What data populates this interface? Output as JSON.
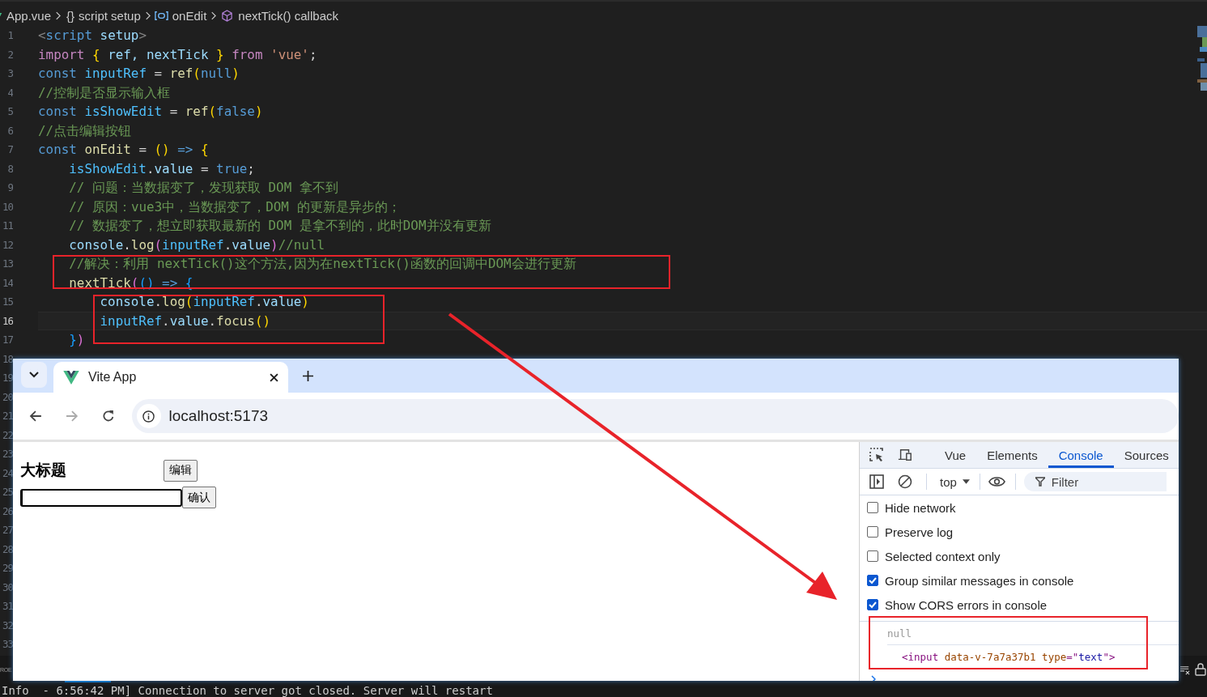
{
  "breadcrumbs": [
    {
      "kind": "file",
      "label": "App.vue"
    },
    {
      "kind": "block",
      "symbol": "{}",
      "label": "script setup"
    },
    {
      "kind": "variable",
      "label": "onEdit"
    },
    {
      "kind": "method",
      "label": "nextTick() callback"
    }
  ],
  "code": {
    "lines": [
      {
        "number": "1",
        "current": false,
        "tokens": [
          {
            "text": "<",
            "kind": "tagp"
          },
          {
            "text": "script ",
            "kind": "tag"
          },
          {
            "text": "setup",
            "kind": "var"
          },
          {
            "text": ">",
            "kind": "tagp"
          }
        ]
      },
      {
        "number": "2",
        "current": false,
        "tokens": [
          {
            "text": "import ",
            "kind": "keyword"
          },
          {
            "text": "{",
            "kind": "b1"
          },
          {
            "text": " ref, nextTick ",
            "kind": "var"
          },
          {
            "text": "}",
            "kind": "b1"
          },
          {
            "text": " from ",
            "kind": "keyword"
          },
          {
            "text": "'vue'",
            "kind": "string"
          },
          {
            "text": ";",
            "kind": "punct"
          }
        ]
      },
      {
        "number": "3",
        "current": false,
        "tokens": [
          {
            "text": "const ",
            "kind": "storage"
          },
          {
            "text": "inputRef",
            "kind": "const"
          },
          {
            "text": " = ",
            "kind": "punct"
          },
          {
            "text": "ref",
            "kind": "func"
          },
          {
            "text": "(",
            "kind": "b1"
          },
          {
            "text": "null",
            "kind": "storage"
          },
          {
            "text": ")",
            "kind": "b1"
          }
        ]
      },
      {
        "number": "4",
        "current": false,
        "tokens": [
          {
            "text": "//控制是否显示输入框",
            "kind": "comment"
          }
        ]
      },
      {
        "number": "5",
        "current": false,
        "tokens": [
          {
            "text": "const ",
            "kind": "storage"
          },
          {
            "text": "isShowEdit",
            "kind": "const"
          },
          {
            "text": " = ",
            "kind": "punct"
          },
          {
            "text": "ref",
            "kind": "func"
          },
          {
            "text": "(",
            "kind": "b1"
          },
          {
            "text": "false",
            "kind": "storage"
          },
          {
            "text": ")",
            "kind": "b1"
          }
        ]
      },
      {
        "number": "6",
        "current": false,
        "tokens": [
          {
            "text": "//点击编辑按钮",
            "kind": "comment"
          }
        ]
      },
      {
        "number": "7",
        "current": false,
        "tokens": [
          {
            "text": "const ",
            "kind": "storage"
          },
          {
            "text": "onEdit",
            "kind": "func"
          },
          {
            "text": " = ",
            "kind": "punct"
          },
          {
            "text": "()",
            "kind": "b1"
          },
          {
            "text": " => ",
            "kind": "storage"
          },
          {
            "text": "{",
            "kind": "b1"
          }
        ]
      },
      {
        "number": "8",
        "current": false,
        "tokens": [
          {
            "text": "    isShowEdit",
            "kind": "const"
          },
          {
            "text": ".",
            "kind": "punct"
          },
          {
            "text": "value",
            "kind": "var"
          },
          {
            "text": " = ",
            "kind": "punct"
          },
          {
            "text": "true",
            "kind": "storage"
          },
          {
            "text": ";",
            "kind": "punct"
          }
        ]
      },
      {
        "number": "9",
        "current": false,
        "tokens": [
          {
            "text": "    // 问题：当数据变了，发现获取 DOM 拿不到",
            "kind": "comment"
          }
        ]
      },
      {
        "number": "10",
        "current": false,
        "tokens": [
          {
            "text": "    // 原因：vue3中，当数据变了，DOM 的更新是异步的；",
            "kind": "comment"
          }
        ]
      },
      {
        "number": "11",
        "current": false,
        "tokens": [
          {
            "text": "    // 数据变了，想立即获取最新的 DOM 是拿不到的，此时DOM并没有更新",
            "kind": "comment"
          }
        ]
      },
      {
        "number": "12",
        "current": false,
        "tokens": [
          {
            "text": "    console",
            "kind": "var"
          },
          {
            "text": ".",
            "kind": "punct"
          },
          {
            "text": "log",
            "kind": "func"
          },
          {
            "text": "(",
            "kind": "b2"
          },
          {
            "text": "inputRef",
            "kind": "const"
          },
          {
            "text": ".",
            "kind": "punct"
          },
          {
            "text": "value",
            "kind": "var"
          },
          {
            "text": ")",
            "kind": "b2"
          },
          {
            "text": "//null",
            "kind": "comment"
          }
        ]
      },
      {
        "number": "13",
        "current": false,
        "tokens": [
          {
            "text": "    //解决：利用 nextTick()这个方法,因为在nextTick()函数的回调中DOM会进行更新",
            "kind": "comment"
          }
        ]
      },
      {
        "number": "14",
        "current": false,
        "tokens": [
          {
            "text": "    nextTick",
            "kind": "func"
          },
          {
            "text": "(",
            "kind": "b2"
          },
          {
            "text": "()",
            "kind": "b3"
          },
          {
            "text": " => ",
            "kind": "storage"
          },
          {
            "text": "{",
            "kind": "b3"
          }
        ]
      },
      {
        "number": "15",
        "current": false,
        "tokens": [
          {
            "text": "        console",
            "kind": "var"
          },
          {
            "text": ".",
            "kind": "punct"
          },
          {
            "text": "log",
            "kind": "func"
          },
          {
            "text": "(",
            "kind": "b1"
          },
          {
            "text": "inputRef",
            "kind": "const"
          },
          {
            "text": ".",
            "kind": "punct"
          },
          {
            "text": "value",
            "kind": "var"
          },
          {
            "text": ")",
            "kind": "b1"
          }
        ]
      },
      {
        "number": "16",
        "current": true,
        "tokens": [
          {
            "text": "        inputRef",
            "kind": "const"
          },
          {
            "text": ".",
            "kind": "punct"
          },
          {
            "text": "value",
            "kind": "var"
          },
          {
            "text": ".",
            "kind": "punct"
          },
          {
            "text": "focus",
            "kind": "func"
          },
          {
            "text": "()",
            "kind": "b1"
          }
        ]
      },
      {
        "number": "17",
        "current": false,
        "tokens": [
          {
            "text": "    }",
            "kind": "b3"
          },
          {
            "text": ")",
            "kind": "b2"
          }
        ]
      }
    ],
    "hidden_line_numbers": [
      "18",
      "19",
      "20",
      "21",
      "22",
      "23",
      "24",
      "25",
      "26",
      "27",
      "28",
      "29",
      "30",
      "31",
      "32",
      "33"
    ]
  },
  "panel_tab": "ROE",
  "terminal_line": "Info  - 6:56:42 PM] Connection to server got closed. Server will restart",
  "browser": {
    "tab_title": "Vite App",
    "address": "localhost:5173",
    "page": {
      "heading": "大标题",
      "edit_button": "编辑",
      "confirm_button": "确认"
    },
    "devtools": {
      "tabs": [
        {
          "label": "Vue",
          "selected": false
        },
        {
          "label": "Elements",
          "selected": false
        },
        {
          "label": "Console",
          "selected": true
        },
        {
          "label": "Sources",
          "selected": false
        }
      ],
      "context": "top",
      "filter_placeholder": "Filter",
      "settings": [
        {
          "label": "Hide network",
          "checked": false
        },
        {
          "label": "Preserve log",
          "checked": false
        },
        {
          "label": "Selected context only",
          "checked": false
        },
        {
          "label": "Group similar messages in console",
          "checked": true
        },
        {
          "label": "Show CORS errors in console",
          "checked": true
        }
      ],
      "console": [
        {
          "kind": "value",
          "text": "null"
        },
        {
          "kind": "element",
          "tokens": [
            {
              "text": "<input",
              "kind": "tag"
            },
            {
              "text": " data-v-7a7a37b1",
              "kind": "attr"
            },
            {
              "text": " type",
              "kind": "attr"
            },
            {
              "text": "=\"",
              "kind": "tag"
            },
            {
              "text": "text",
              "kind": "value"
            },
            {
              "text": "\">",
              "kind": "tag"
            }
          ]
        }
      ]
    }
  }
}
